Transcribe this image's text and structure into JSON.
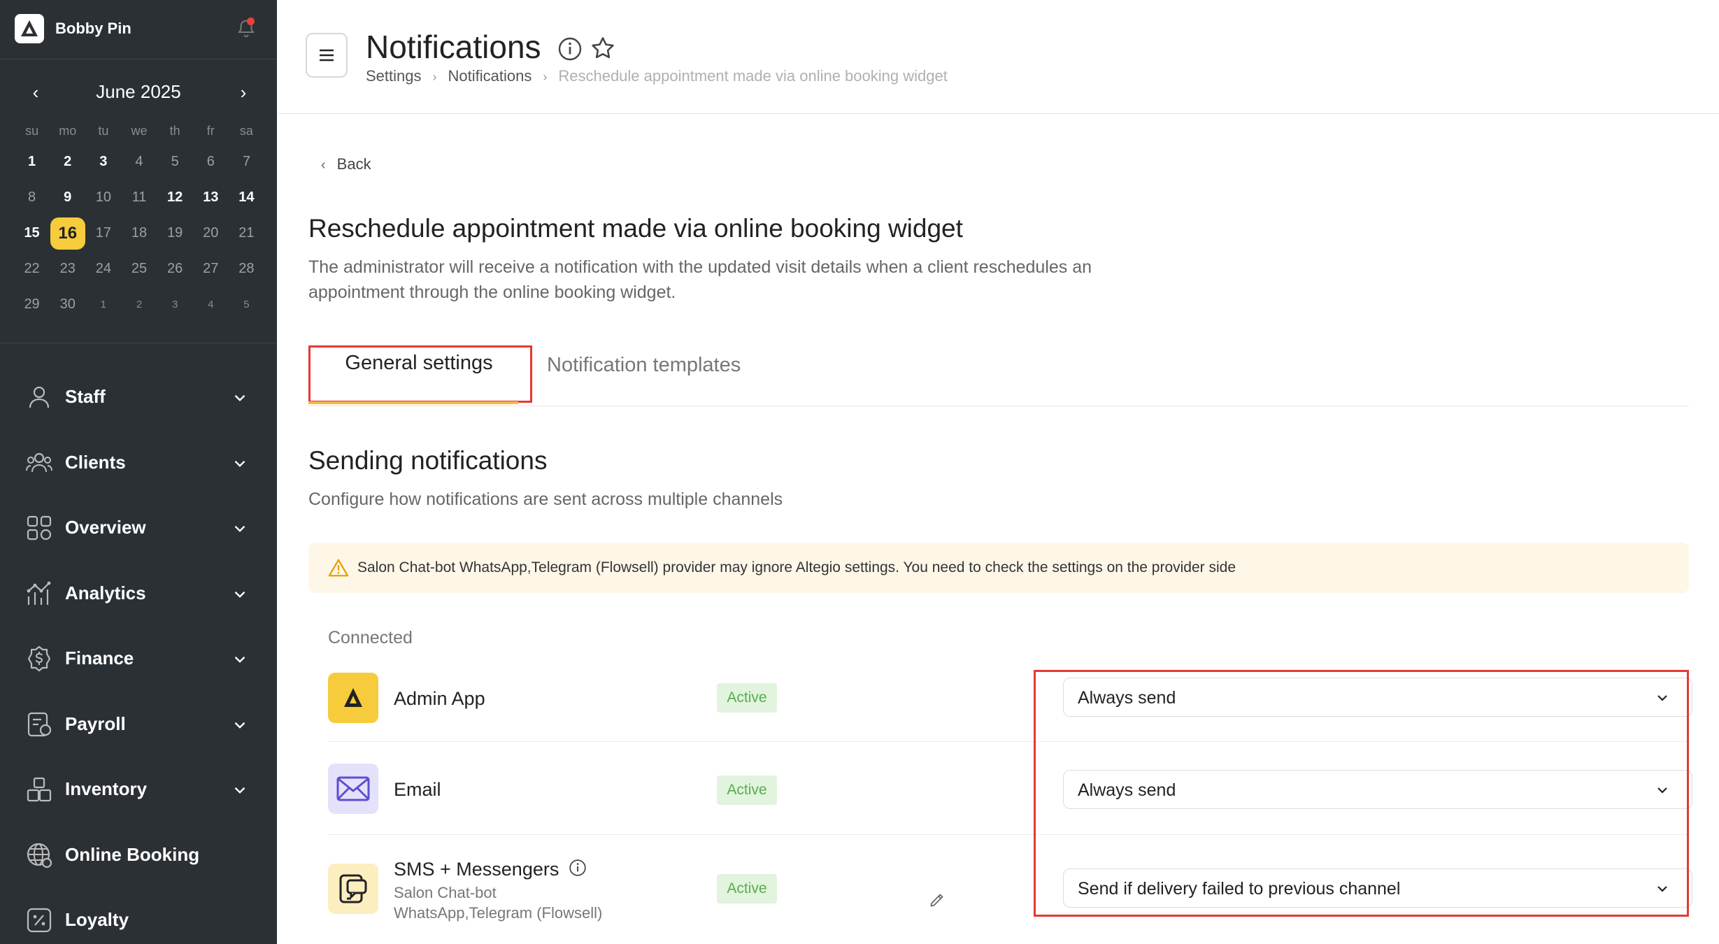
{
  "sidebar": {
    "user_name": "Bobby Pin",
    "calendar": {
      "title": "June 2025",
      "weekdays": [
        "su",
        "mo",
        "tu",
        "we",
        "th",
        "fr",
        "sa"
      ],
      "weeks": [
        [
          {
            "d": "1",
            "b": true
          },
          {
            "d": "2",
            "b": true
          },
          {
            "d": "3",
            "b": true
          },
          {
            "d": "4"
          },
          {
            "d": "5"
          },
          {
            "d": "6"
          },
          {
            "d": "7"
          }
        ],
        [
          {
            "d": "8"
          },
          {
            "d": "9",
            "b": true
          },
          {
            "d": "10"
          },
          {
            "d": "11"
          },
          {
            "d": "12",
            "b": true
          },
          {
            "d": "13",
            "b": true
          },
          {
            "d": "14",
            "b": true
          }
        ],
        [
          {
            "d": "15",
            "b": true
          },
          {
            "d": "16",
            "today": true
          },
          {
            "d": "17"
          },
          {
            "d": "18"
          },
          {
            "d": "19"
          },
          {
            "d": "20"
          },
          {
            "d": "21"
          }
        ],
        [
          {
            "d": "22"
          },
          {
            "d": "23"
          },
          {
            "d": "24"
          },
          {
            "d": "25"
          },
          {
            "d": "26"
          },
          {
            "d": "27"
          },
          {
            "d": "28"
          }
        ],
        [
          {
            "d": "29"
          },
          {
            "d": "30"
          },
          {
            "d": "1",
            "m": true
          },
          {
            "d": "2",
            "m": true
          },
          {
            "d": "3",
            "m": true
          },
          {
            "d": "4",
            "m": true
          },
          {
            "d": "5",
            "m": true
          }
        ]
      ]
    },
    "nav": [
      {
        "label": "Staff",
        "icon": "person-icon",
        "expandable": true
      },
      {
        "label": "Clients",
        "icon": "people-icon",
        "expandable": true
      },
      {
        "label": "Overview",
        "icon": "grid-icon",
        "expandable": true
      },
      {
        "label": "Analytics",
        "icon": "analytics-icon",
        "expandable": true
      },
      {
        "label": "Finance",
        "icon": "dollar-icon",
        "expandable": true
      },
      {
        "label": "Payroll",
        "icon": "payroll-icon",
        "expandable": true
      },
      {
        "label": "Inventory",
        "icon": "boxes-icon",
        "expandable": true
      },
      {
        "label": "Online Booking",
        "icon": "globe-icon",
        "expandable": false
      },
      {
        "label": "Loyalty",
        "icon": "percent-icon",
        "expandable": false
      }
    ]
  },
  "header": {
    "title": "Notifications",
    "breadcrumbs": [
      "Settings",
      "Notifications",
      "Reschedule appointment made via online booking widget"
    ]
  },
  "main": {
    "back_label": "Back",
    "heading": "Reschedule appointment made via online booking widget",
    "description": "The administrator will receive a notification with the updated visit details when a client reschedules an appointment through the online booking widget.",
    "tabs": [
      "General settings",
      "Notification templates"
    ],
    "section_title": "Sending notifications",
    "section_subtitle": "Configure how notifications are sent across multiple channels",
    "warning": "Salon Chat-bot WhatsApp,Telegram (Flowsell) provider may ignore Altegio settings. You need to check the settings on the provider side",
    "connected_label": "Connected",
    "channels": [
      {
        "name": "Admin App",
        "status": "Active",
        "mode": "Always send"
      },
      {
        "name": "Email",
        "status": "Active",
        "mode": "Always send"
      },
      {
        "name": "SMS + Messengers",
        "provider_line1": "Salon Chat-bot",
        "provider_line2": "WhatsApp,Telegram (Flowsell)",
        "status": "Active",
        "mode": "Send if delivery failed to previous channel"
      }
    ]
  },
  "colors": {
    "sidebar_bg": "#2b3035",
    "accent_yellow": "#f6cb3c",
    "active_green": "#54b04a",
    "highlight_red": "#e53935"
  }
}
